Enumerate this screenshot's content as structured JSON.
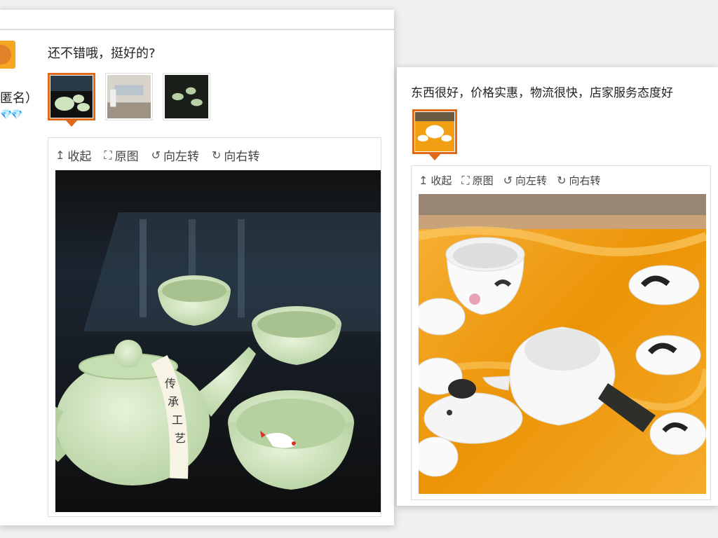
{
  "left_review": {
    "comment": "还不错哦，挺好的?",
    "author_suffix": "匿名）",
    "rating_hearts": "💎💎",
    "toolbar": {
      "collapse": "收起",
      "original": "原图",
      "rotate_left": "向左转",
      "rotate_right": "向右转"
    },
    "thumbnails": [
      "teaset-dark",
      "room",
      "cups-dark"
    ],
    "photo_text": "传承工艺"
  },
  "right_review": {
    "comment": "东西很好，价格实惠，物流很快，店家服务态度好",
    "toolbar": {
      "collapse": "收起",
      "original": "原图",
      "rotate_left": "向左转",
      "rotate_right": "向右转"
    },
    "thumbnails": [
      "teaset-gift-box"
    ]
  },
  "colors": {
    "accent": "#e0681a",
    "celadon": "#cfe3bf",
    "silk": "#f2a013"
  },
  "icons": {
    "collapse": "arrow-up-icon",
    "original": "expand-icon",
    "rotate_left": "rotate-left-icon",
    "rotate_right": "rotate-right-icon"
  }
}
